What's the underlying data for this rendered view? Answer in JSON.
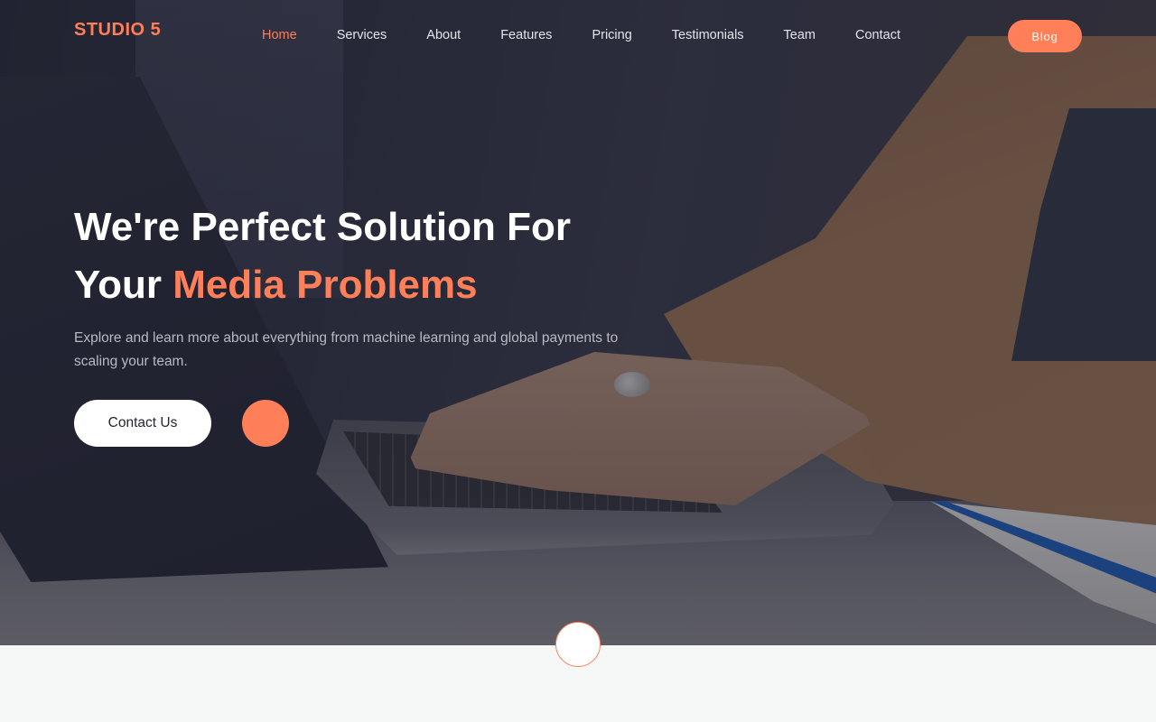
{
  "brand": {
    "name": "STUDIO 5"
  },
  "nav": {
    "items": [
      {
        "label": "Home",
        "active": true
      },
      {
        "label": "Services"
      },
      {
        "label": "About"
      },
      {
        "label": "Features"
      },
      {
        "label": "Pricing"
      },
      {
        "label": "Testimonials"
      },
      {
        "label": "Team"
      },
      {
        "label": "Contact"
      }
    ],
    "cta_label": "Blog"
  },
  "hero": {
    "headline_line1": "We're Perfect Solution For",
    "headline_line2_plain": "Your ",
    "headline_line2_accent": "Media Problems",
    "subtext": "Explore and learn more about everything from machine learning and global payments to scaling your team.",
    "contact_button": "Contact Us",
    "play_icon": "play-icon"
  },
  "colors": {
    "accent": "#ff7f59",
    "hero_overlay": "#2b2d3c",
    "section_bg": "#f6f8f8"
  }
}
